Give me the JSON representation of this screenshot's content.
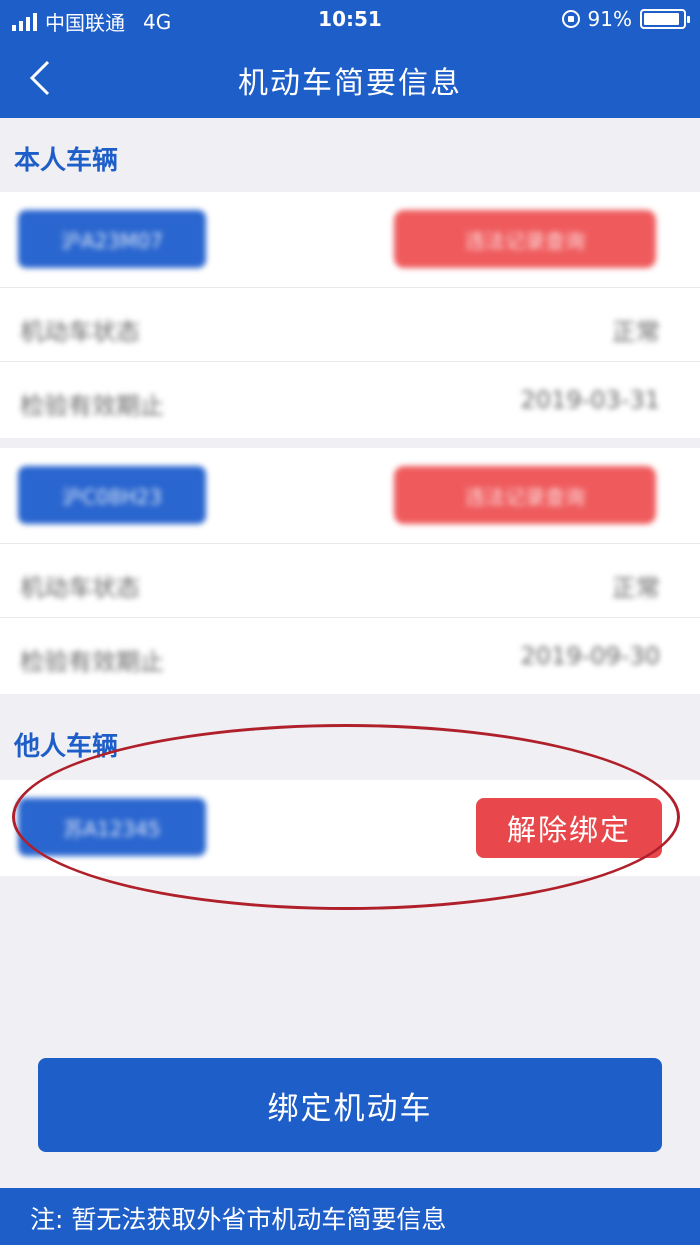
{
  "status_bar": {
    "carrier": "中国联通",
    "network": "4G",
    "time": "10:51",
    "battery": "91%",
    "battery_level": 0.91
  },
  "nav": {
    "title": "机动车简要信息",
    "back_icon": "chevron-left-icon"
  },
  "own_section": {
    "title": "本人车辆",
    "vehicles": [
      {
        "plate": "沪A23M07",
        "action": "违法记录查询",
        "status_label": "机动车状态",
        "status_value": "正常",
        "inspection_label": "检验有效期止",
        "inspection_value": "2019-03-31"
      },
      {
        "plate": "沪C08H23",
        "action": "违法记录查询",
        "status_label": "机动车状态",
        "status_value": "正常",
        "inspection_label": "检验有效期止",
        "inspection_value": "2019-09-30"
      }
    ]
  },
  "other_section": {
    "title": "他人车辆",
    "vehicle": {
      "plate": "苏A12345",
      "unbind_label": "解除绑定"
    }
  },
  "bind_button_label": "绑定机动车",
  "footer_note": "注: 暂无法获取外省市机动车简要信息",
  "colors": {
    "primary": "#1e5ec8",
    "danger": "#e8484b",
    "background": "#efeff4",
    "highlight": "#b0202a"
  }
}
